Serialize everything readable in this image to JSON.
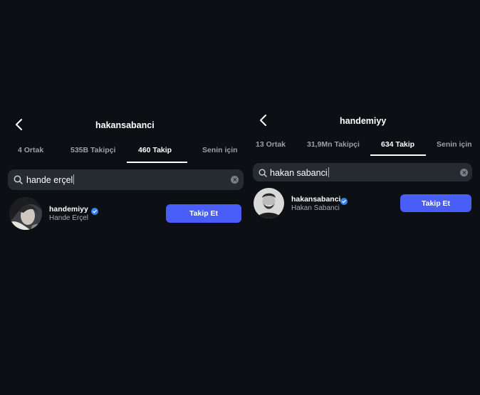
{
  "left": {
    "title": "hakansabanci",
    "tabs": [
      "4 Ortak",
      "535B Takipçi",
      "460 Takip",
      "Senin için"
    ],
    "active_tab": 2,
    "search_value": "hande erçel",
    "result": {
      "username": "handemiyy",
      "fullname": "Hande Erçel",
      "verified": true,
      "button": "Takip Et"
    }
  },
  "right": {
    "title": "handemiyy",
    "tabs": [
      "13 Ortak",
      "31,9Mn Takipçi",
      "634 Takip",
      "Senin için"
    ],
    "active_tab": 2,
    "search_value": "hakan sabanci",
    "result": {
      "username": "hakansabanci",
      "fullname": "Hakan Sabanci",
      "verified": true,
      "button": "Takip Et"
    }
  },
  "icons": {
    "back": "chevron-left-icon",
    "search": "search-icon",
    "clear": "clear-icon",
    "verified": "verified-badge-icon"
  },
  "colors": {
    "background": "#0c0f14",
    "search_bg": "#262a31",
    "button": "#4a5df6",
    "verified": "#3b82f6"
  }
}
